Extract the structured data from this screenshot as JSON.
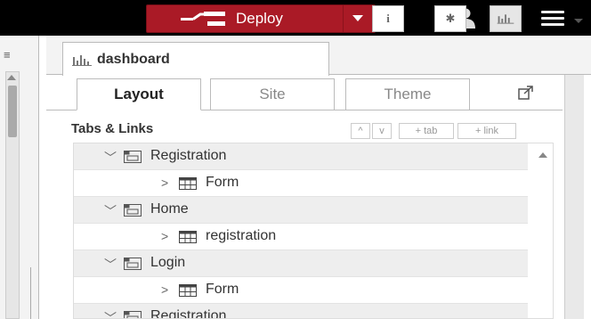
{
  "header": {
    "deploy_label": "Deploy",
    "deploy_color": "#aa1a26",
    "icons": {
      "deploy": "deploy-icon",
      "caret": "chevron-down-icon",
      "user": "user-icon",
      "menu": "menu-icon"
    }
  },
  "sidebar": {
    "active_tab": {
      "label": "dashboard",
      "icon": "bar-chart-icon"
    },
    "toolbar": [
      {
        "name": "info-icon",
        "glyph": "i"
      },
      {
        "name": "bug-icon",
        "glyph": "✱"
      },
      {
        "name": "bar-chart-icon",
        "glyph": ""
      }
    ]
  },
  "dashboard": {
    "subtabs": [
      {
        "label": "Layout",
        "active": true
      },
      {
        "label": "Site",
        "active": false
      },
      {
        "label": "Theme",
        "active": false
      }
    ],
    "section_title": "Tabs & Links",
    "buttons": {
      "up": "^",
      "down": "v",
      "add_tab": "+ tab",
      "add_link": "+ link"
    },
    "tree": [
      {
        "type": "tab",
        "label": "Registration"
      },
      {
        "type": "group",
        "label": "Form"
      },
      {
        "type": "tab",
        "label": "Home"
      },
      {
        "type": "group",
        "label": "registration"
      },
      {
        "type": "tab",
        "label": "Login"
      },
      {
        "type": "group",
        "label": "Form"
      },
      {
        "type": "tab",
        "label": "Registration"
      }
    ]
  }
}
